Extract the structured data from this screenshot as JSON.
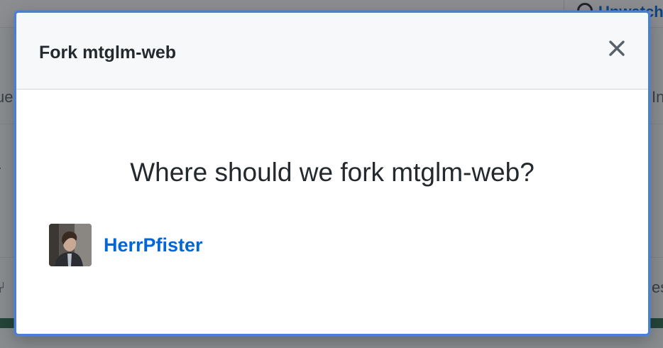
{
  "background": {
    "watch_label": "Unwatch",
    "left_fragments": [
      "ue",
      "r"
    ],
    "right_fragments": [
      "In",
      "es"
    ]
  },
  "dialog": {
    "title": "Fork mtglm-web",
    "close_icon": "close-icon",
    "question": "Where should we fork mtglm-web?",
    "targets": [
      {
        "account": "HerrPfister",
        "avatar_icon": "user-avatar"
      }
    ]
  },
  "colors": {
    "link": "#0366d6",
    "text": "#24292e",
    "header_bg": "#f6f8fa",
    "focus_border": "#4a7fd6"
  }
}
